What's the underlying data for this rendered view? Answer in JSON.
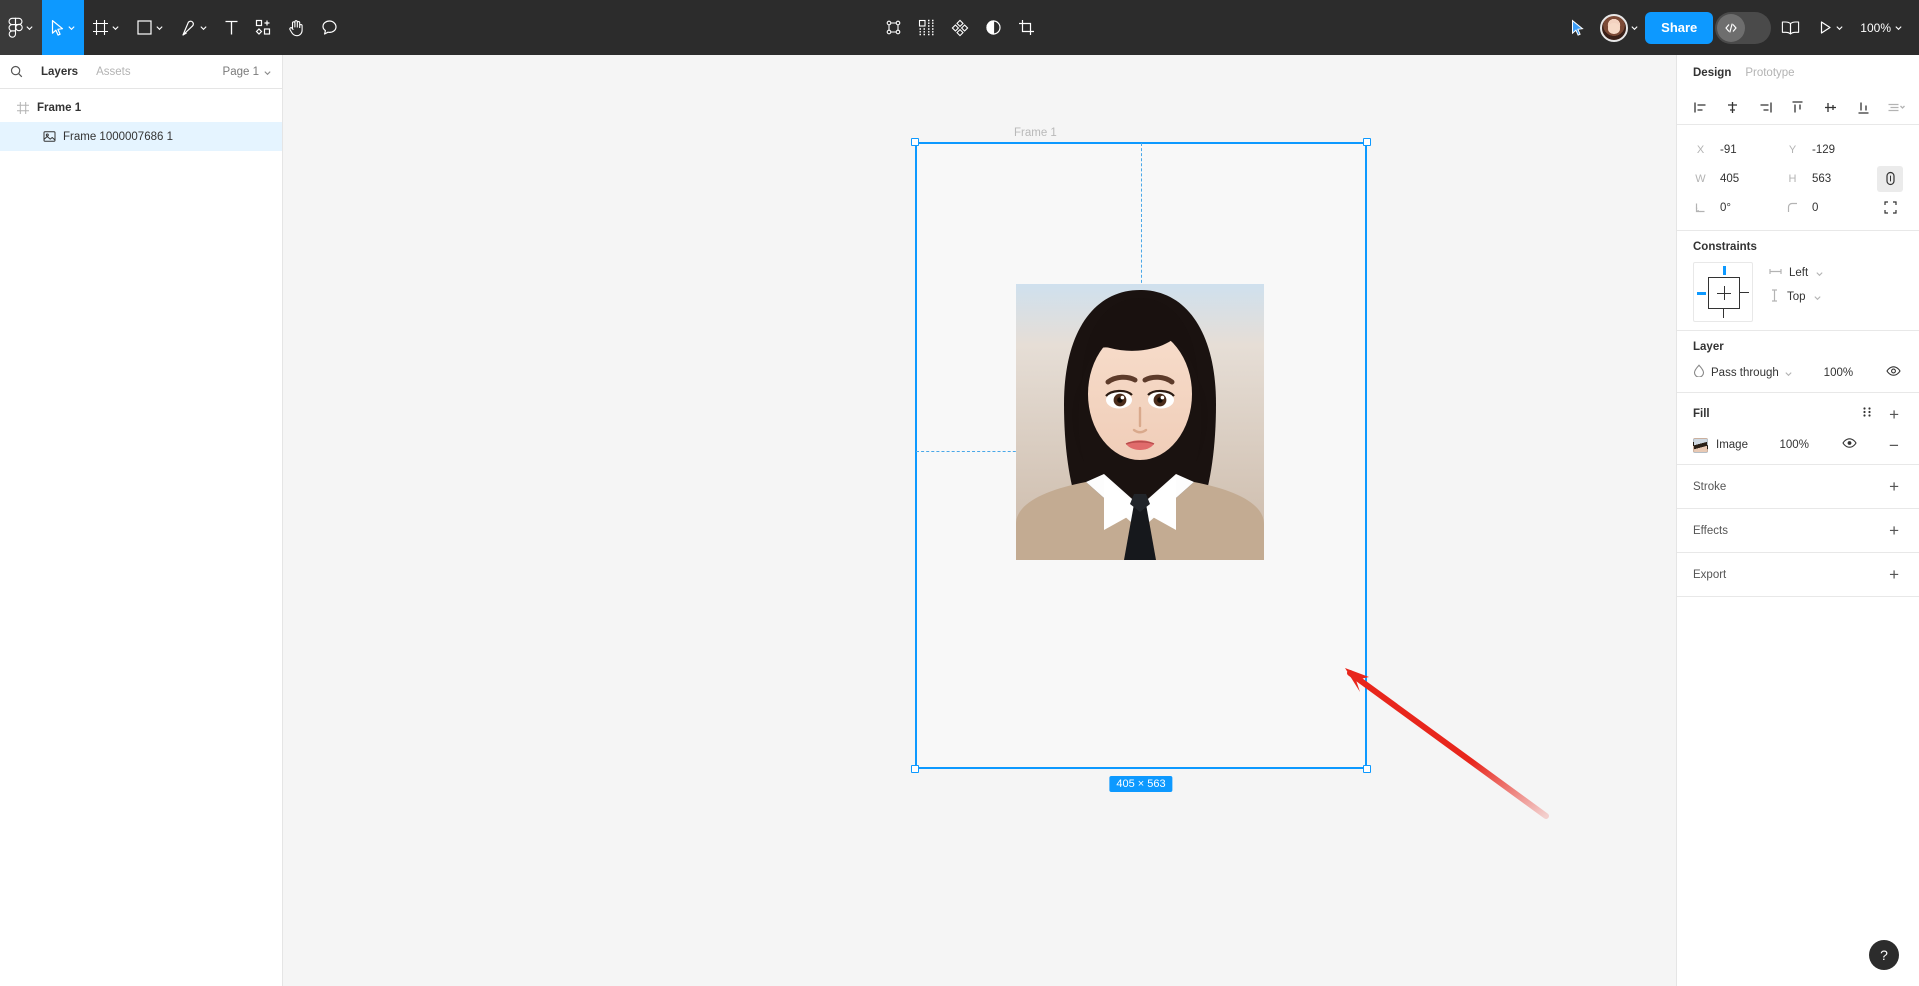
{
  "toolbar": {
    "left_tools": [
      {
        "name": "figma-menu",
        "icon": "figma-logo-icon",
        "caret": true,
        "active": false
      },
      {
        "name": "move-tool",
        "icon": "cursor-arrow-icon",
        "caret": true,
        "active": true
      },
      {
        "name": "frame-tool",
        "icon": "frame-icon",
        "caret": true,
        "active": false
      },
      {
        "name": "shape-tool",
        "icon": "rectangle-icon",
        "caret": true,
        "active": false
      },
      {
        "name": "pen-tool",
        "icon": "pen-icon",
        "caret": true,
        "active": false
      },
      {
        "name": "text-tool",
        "icon": "text-t-icon",
        "caret": false,
        "active": false
      },
      {
        "name": "resources-tool",
        "icon": "resources-icon",
        "caret": false,
        "active": false
      },
      {
        "name": "hand-tool",
        "icon": "hand-icon",
        "caret": false,
        "active": false
      },
      {
        "name": "comment-tool",
        "icon": "comment-bubble-icon",
        "caret": false,
        "active": false
      }
    ],
    "center_tools": [
      {
        "name": "selection-bounds",
        "icon": "selection-nodes-icon"
      },
      {
        "name": "components",
        "icon": "component-grid-icon"
      },
      {
        "name": "plugins",
        "icon": "diamond-cluster-icon"
      },
      {
        "name": "contrast",
        "icon": "half-circle-icon"
      },
      {
        "name": "crop",
        "icon": "crop-icon"
      }
    ],
    "right": {
      "present_cursor_icon": "blue-cursor-icon",
      "avatar_name": "user-avatar",
      "share_label": "Share",
      "dev_mode_icon": "code-brackets-icon",
      "library_icon": "book-icon",
      "play_icon": "play-triangle-icon",
      "zoom_level": "100%"
    }
  },
  "left_panel": {
    "search_icon": "search-icon",
    "tabs": [
      {
        "label": "Layers",
        "active": true
      },
      {
        "label": "Assets",
        "active": false
      }
    ],
    "page_selector": "Page 1",
    "layers": [
      {
        "name": "Frame 1",
        "icon": "frame-hash-icon",
        "depth": 0,
        "selected": false
      },
      {
        "name": "Frame 1000007686 1",
        "icon": "image-icon",
        "depth": 1,
        "selected": true
      }
    ]
  },
  "canvas": {
    "frame_label": "Frame 1",
    "dimension_badge": "405 × 563",
    "selection_color": "#0d99ff",
    "annotation_arrow_color": "#e8261c"
  },
  "right_panel": {
    "tabs": [
      {
        "label": "Design",
        "active": true
      },
      {
        "label": "Prototype",
        "active": false
      }
    ],
    "align_buttons": [
      {
        "name": "align-left",
        "icon": "align-left-icon"
      },
      {
        "name": "align-horizontal-center",
        "icon": "align-h-center-icon"
      },
      {
        "name": "align-right",
        "icon": "align-right-icon"
      },
      {
        "name": "align-top",
        "icon": "align-top-icon"
      },
      {
        "name": "align-vertical-center",
        "icon": "align-v-center-icon"
      },
      {
        "name": "align-bottom",
        "icon": "align-bottom-icon"
      },
      {
        "name": "distribute-menu",
        "icon": "distribute-icon"
      }
    ],
    "transform": {
      "x_label": "X",
      "x_value": "-91",
      "y_label": "Y",
      "y_value": "-129",
      "w_label": "W",
      "w_value": "405",
      "h_label": "H",
      "h_value": "563",
      "rotation_label": "rotation",
      "rotation_value": "0°",
      "corner_label": "corner-radius",
      "corner_value": "0",
      "lock_ratio_icon": "link-ratio-icon",
      "independent_corners_icon": "independent-corners-icon"
    },
    "constraints": {
      "title": "Constraints",
      "horizontal": "Left",
      "vertical": "Top",
      "h_icon": "horizontal-constraint-icon",
      "v_icon": "vertical-constraint-icon"
    },
    "layer": {
      "title": "Layer",
      "blend_mode": "Pass through",
      "opacity": "100%",
      "blend_icon": "blend-drop-icon",
      "visibility_icon": "eye-icon"
    },
    "fill": {
      "title": "Fill",
      "items": [
        {
          "label": "Image",
          "opacity": "100%"
        }
      ],
      "styles_icon": "style-dots-icon",
      "add_icon": "plus-icon",
      "visibility_icon": "eye-icon",
      "remove_icon": "minus-icon"
    },
    "collapsed_sections": [
      {
        "title": "Stroke",
        "add_icon": "plus-icon"
      },
      {
        "title": "Effects",
        "add_icon": "plus-icon"
      },
      {
        "title": "Export",
        "add_icon": "plus-icon"
      }
    ]
  },
  "help": {
    "label": "?",
    "name": "help-button"
  }
}
